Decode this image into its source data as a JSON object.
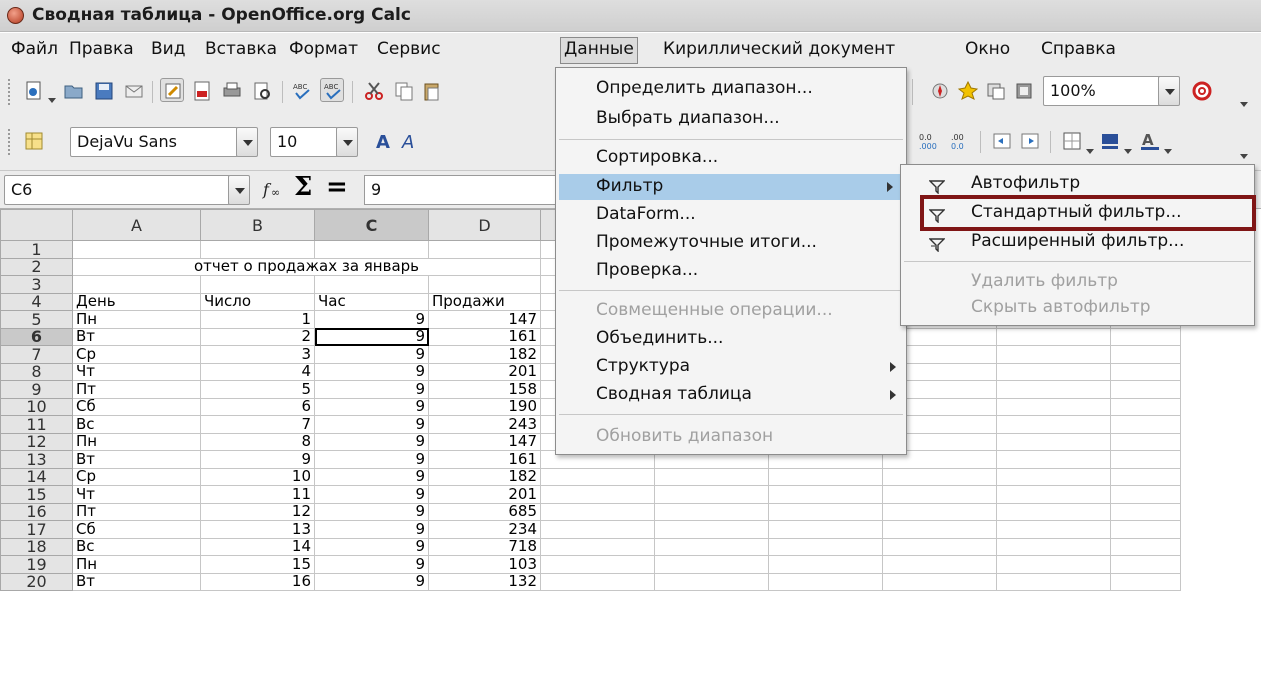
{
  "window": {
    "title": "Сводная таблица - OpenOffice.org Calc"
  },
  "menubar": {
    "items": [
      "Файл",
      "Правка",
      "Вид",
      "Вставка",
      "Формат",
      "Сервис",
      "Данные",
      "Кириллический документ",
      "Окно",
      "Справка"
    ],
    "active": "Данные"
  },
  "toolbar1": {
    "zoom": "100%"
  },
  "toolbar2": {
    "font_name": "DejaVu Sans",
    "font_size": "10"
  },
  "formula_bar": {
    "cell_ref": "C6",
    "function_icon": "fx-icon",
    "sum_symbol": "Σ",
    "equals_symbol": "=",
    "content": "9"
  },
  "sheet": {
    "columns": [
      "A",
      "B",
      "C",
      "D"
    ],
    "row_numbers": [
      "1",
      "2",
      "3",
      "4",
      "5",
      "6",
      "7",
      "8",
      "9",
      "10",
      "11",
      "12",
      "13",
      "14",
      "15",
      "16",
      "17",
      "18",
      "19",
      "20"
    ],
    "title": "отчет о продажах за январь",
    "headers": [
      "День",
      "Число",
      "Час",
      "Продажи"
    ],
    "rows": [
      [
        "Пн",
        "1",
        "9",
        "147"
      ],
      [
        "Вт",
        "2",
        "9",
        "161"
      ],
      [
        "Ср",
        "3",
        "9",
        "182"
      ],
      [
        "Чт",
        "4",
        "9",
        "201"
      ],
      [
        "Пт",
        "5",
        "9",
        "158"
      ],
      [
        "Сб",
        "6",
        "9",
        "190"
      ],
      [
        "Вс",
        "7",
        "9",
        "243"
      ],
      [
        "Пн",
        "8",
        "9",
        "147"
      ],
      [
        "Вт",
        "9",
        "9",
        "161"
      ],
      [
        "Ср",
        "10",
        "9",
        "182"
      ],
      [
        "Чт",
        "11",
        "9",
        "201"
      ],
      [
        "Пт",
        "12",
        "9",
        "685"
      ],
      [
        "Сб",
        "13",
        "9",
        "234"
      ],
      [
        "Вс",
        "14",
        "9",
        "718"
      ],
      [
        "Пн",
        "15",
        "9",
        "103"
      ],
      [
        "Вт",
        "16",
        "9",
        "132"
      ]
    ],
    "selected_cell": "C6"
  },
  "data_menu": {
    "items": [
      {
        "label": "Определить диапазон...",
        "disabled": false
      },
      {
        "label": "Выбрать диапазон...",
        "disabled": false
      },
      {
        "label": "Сортировка...",
        "disabled": false
      },
      {
        "label": "Фильтр",
        "disabled": false,
        "submenu": true
      },
      {
        "label": "DataForm...",
        "disabled": false
      },
      {
        "label": "Промежуточные итоги...",
        "disabled": false
      },
      {
        "label": "Проверка...",
        "disabled": false
      },
      {
        "label": "Совмещенные операции...",
        "disabled": true
      },
      {
        "label": "Объединить...",
        "disabled": false
      },
      {
        "label": "Структура",
        "disabled": false,
        "submenu": true
      },
      {
        "label": "Сводная таблица",
        "disabled": false,
        "submenu": true
      },
      {
        "label": "Обновить диапазон",
        "disabled": true
      }
    ]
  },
  "filter_submenu": {
    "items": [
      {
        "label": "Автофильтр",
        "icon": "autofilter-icon",
        "disabled": false
      },
      {
        "label": "Стандартный фильтр...",
        "icon": "standard-filter-icon",
        "disabled": false
      },
      {
        "label": "Расширенный фильтр...",
        "icon": "advanced-filter-icon",
        "disabled": false
      },
      {
        "label": "Удалить фильтр",
        "disabled": true
      },
      {
        "label": "Скрыть автофильтр",
        "disabled": true
      }
    ]
  },
  "colors": {
    "menu_highlight": "#a9cce9",
    "annotation_box": "#7f1515"
  }
}
